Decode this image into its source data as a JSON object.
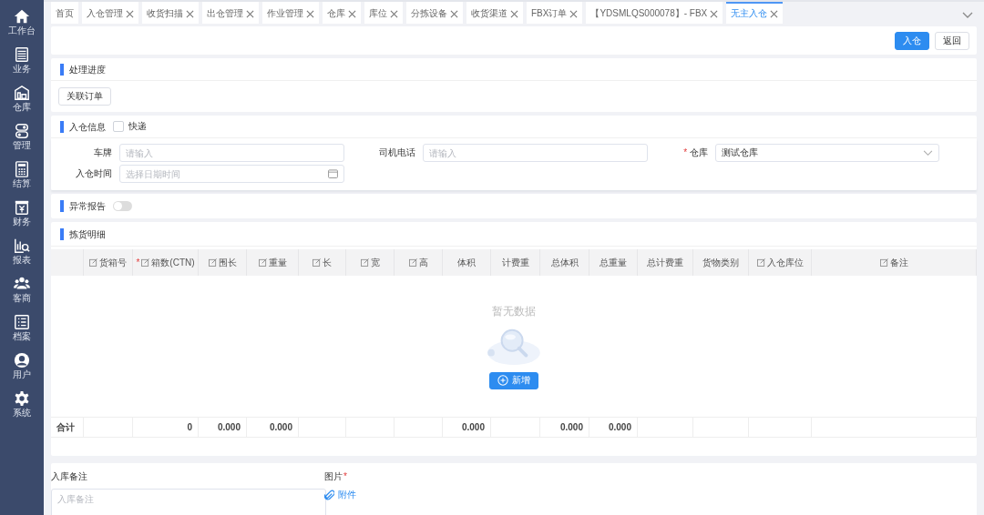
{
  "sidebar": {
    "items": [
      {
        "label": "工作台"
      },
      {
        "label": "业务"
      },
      {
        "label": "仓库"
      },
      {
        "label": "管理"
      },
      {
        "label": "结算"
      },
      {
        "label": "财务"
      },
      {
        "label": "报表"
      },
      {
        "label": "客商"
      },
      {
        "label": "档案"
      },
      {
        "label": "用户"
      },
      {
        "label": "系统"
      }
    ]
  },
  "tabs": [
    {
      "label": "首页",
      "closable": false,
      "selected": false
    },
    {
      "label": "入仓管理",
      "closable": true,
      "selected": false
    },
    {
      "label": "收货扫描",
      "closable": true,
      "selected": false
    },
    {
      "label": "出仓管理",
      "closable": true,
      "selected": false
    },
    {
      "label": "作业管理",
      "closable": true,
      "selected": false
    },
    {
      "label": "仓库",
      "closable": true,
      "selected": false
    },
    {
      "label": "库位",
      "closable": true,
      "selected": false
    },
    {
      "label": "分拣设备",
      "closable": true,
      "selected": false
    },
    {
      "label": "收货渠道",
      "closable": true,
      "selected": false
    },
    {
      "label": "FBX订单",
      "closable": true,
      "selected": false
    },
    {
      "label": "【YDSMLQS000078】- FBX",
      "closable": true,
      "selected": false
    },
    {
      "label": "无主入仓",
      "closable": true,
      "selected": true
    }
  ],
  "toolbar": {
    "buttons": [
      {
        "label": "入仓",
        "kind": "primary"
      },
      {
        "label": "返回",
        "kind": "default"
      }
    ]
  },
  "progress": {
    "title": "处理进度",
    "buttons": [
      "关联订单"
    ]
  },
  "inbound_info": {
    "title": "入仓信息",
    "express": {
      "label": "快递",
      "checked": false
    },
    "fields": [
      {
        "label": "车牌",
        "kind": "text",
        "placeholder": "请输入"
      },
      {
        "label": "司机电话",
        "kind": "text",
        "placeholder": "请输入"
      },
      {
        "label": "仓库",
        "kind": "select",
        "value": "测试仓库",
        "required_mark": "*"
      },
      {
        "label": "入仓时间",
        "kind": "date",
        "placeholder": "选择日期时间"
      }
    ]
  },
  "exception_report": {
    "title": "异常报告",
    "on": false
  },
  "picking_detail": {
    "title": "拣货明细",
    "columns": [
      {
        "total": "合计"
      },
      {
        "label": "货箱号",
        "editable": true
      },
      {
        "label": "箱数(CTN)",
        "editable": true,
        "required_mark": "*",
        "total": "0"
      },
      {
        "label": "围长",
        "editable": true,
        "total": "0.000"
      },
      {
        "label": "重量",
        "editable": true,
        "total": "0.000"
      },
      {
        "label": "长",
        "editable": true
      },
      {
        "label": "宽",
        "editable": true
      },
      {
        "label": "高",
        "editable": true
      },
      {
        "label": "体积",
        "editable": false,
        "total": "0.000"
      },
      {
        "label": "计费重",
        "editable": false
      },
      {
        "label": "总体积",
        "editable": false,
        "total": "0.000"
      },
      {
        "label": "总重量",
        "editable": false,
        "total": "0.000"
      },
      {
        "label": "总计费重",
        "editable": false
      },
      {
        "label": "货物类别",
        "editable": false
      },
      {
        "label": "入仓库位",
        "editable": true
      },
      {
        "label": "备注",
        "editable": true
      }
    ],
    "empty_text": "暂无数据",
    "add_button": "新增"
  },
  "remarks": {
    "label": "入库备注",
    "placeholder": "入库备注"
  },
  "images": {
    "label": "图片",
    "required_mark": "*",
    "attach_link": "附件"
  }
}
